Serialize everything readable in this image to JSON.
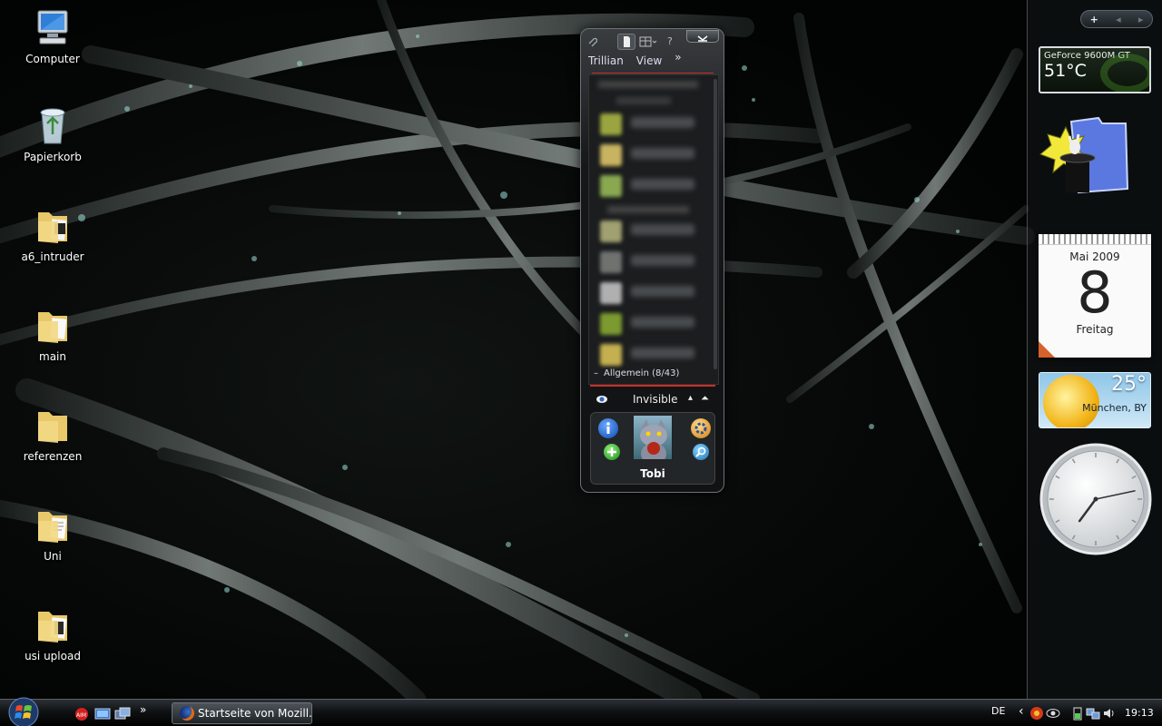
{
  "desktop": {
    "icons": [
      {
        "label": "Computer",
        "kind": "computer"
      },
      {
        "label": "Papierkorb",
        "kind": "recycle-bin"
      },
      {
        "label": "a6_intruder",
        "kind": "folder"
      },
      {
        "label": "main",
        "kind": "folder"
      },
      {
        "label": "referenzen",
        "kind": "folder"
      },
      {
        "label": "Uni",
        "kind": "folder"
      },
      {
        "label": "usi upload",
        "kind": "folder"
      }
    ]
  },
  "sidebar": {
    "controls": {
      "add": "+",
      "prev": "◂",
      "next": "▸"
    },
    "gpu": {
      "name": "GeForce 9600M GT",
      "temperature": "51°C"
    },
    "calendar": {
      "month": "Mai 2009",
      "day": "8",
      "weekday": "Freitag"
    },
    "weather": {
      "temperature": "25°",
      "location": "München, BY"
    },
    "clock": {
      "hour": 7,
      "minute": 13
    }
  },
  "trillian": {
    "menu": [
      "Trillian",
      "View"
    ],
    "more": "»",
    "help": "?",
    "group_label": "Allgemein (8/43)",
    "status": "Invisible",
    "profile_name": "Tobi",
    "contacts": [
      {
        "avatar_color": "#9aa540"
      },
      {
        "avatar_color": "#c8b460"
      },
      {
        "avatar_color": "#8aa850"
      },
      {
        "avatar_color": "#a0a070"
      },
      {
        "avatar_color": "#707270"
      },
      {
        "avatar_color": "#b0b0b0"
      },
      {
        "avatar_color": "#7c9a30"
      },
      {
        "avatar_color": "#c4b050"
      }
    ]
  },
  "taskbar": {
    "quicklaunch_more": "»",
    "tasks": [
      {
        "label": "Startseite von Mozill..."
      }
    ],
    "tray": {
      "language": "DE",
      "expand": "‹",
      "time": "19:13"
    }
  },
  "colors": {
    "accent_red": "#c83028",
    "trillian_border": "#6c7276",
    "taskbar_top": "#2b3035"
  }
}
